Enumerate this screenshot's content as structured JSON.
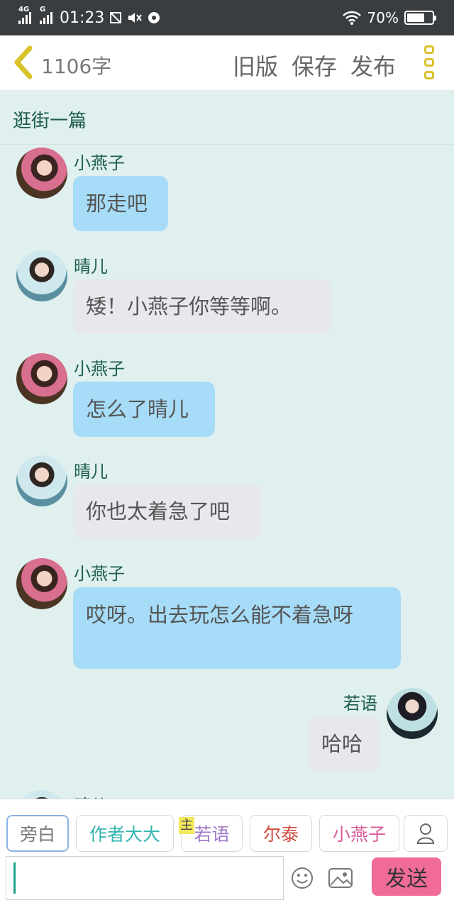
{
  "status_bar": {
    "network1": "4G",
    "network2": "G",
    "time": "01:23",
    "battery": "70%",
    "battery_level": 0.7
  },
  "header": {
    "word_count": "1106字",
    "old_version": "旧版",
    "save": "保存",
    "publish": "发布"
  },
  "document": {
    "title": "逛街一篇"
  },
  "messages": [
    {
      "speaker": "小燕子",
      "text": "那走吧",
      "side": "left",
      "bubble": "blue"
    },
    {
      "speaker": "晴儿",
      "text": "矮！小燕子你等等啊。",
      "side": "left",
      "bubble": "grey"
    },
    {
      "speaker": "小燕子",
      "text": "怎么了晴儿",
      "side": "left",
      "bubble": "blue"
    },
    {
      "speaker": "晴儿",
      "text": "你也太着急了吧",
      "side": "left",
      "bubble": "grey"
    },
    {
      "speaker": "小燕子",
      "text": "哎呀。出去玩怎么能不着急呀",
      "side": "left",
      "bubble": "blue"
    },
    {
      "speaker": "若语",
      "text": "哈哈",
      "side": "right",
      "bubble": "grey"
    },
    {
      "speaker": "晴儿",
      "text": "",
      "side": "left",
      "bubble": "none"
    }
  ],
  "roles": [
    {
      "label": "旁白",
      "active": true
    },
    {
      "label": "作者大大",
      "active": false
    },
    {
      "label": "若语",
      "active": false,
      "tag": "主"
    },
    {
      "label": "尔泰",
      "active": false
    },
    {
      "label": "小燕子",
      "active": false
    }
  ],
  "input": {
    "value": "",
    "placeholder": ""
  },
  "send_label": "发送",
  "colors": {
    "status_bar_bg": "#3a3d40",
    "chat_bg": "#dff0ef",
    "bubble_blue": "#a6dcf7",
    "bubble_grey": "#e7e8ed",
    "send_button": "#f06b96",
    "back_chevron": "#d8c22a",
    "speaker_name": "#1f5d51"
  }
}
